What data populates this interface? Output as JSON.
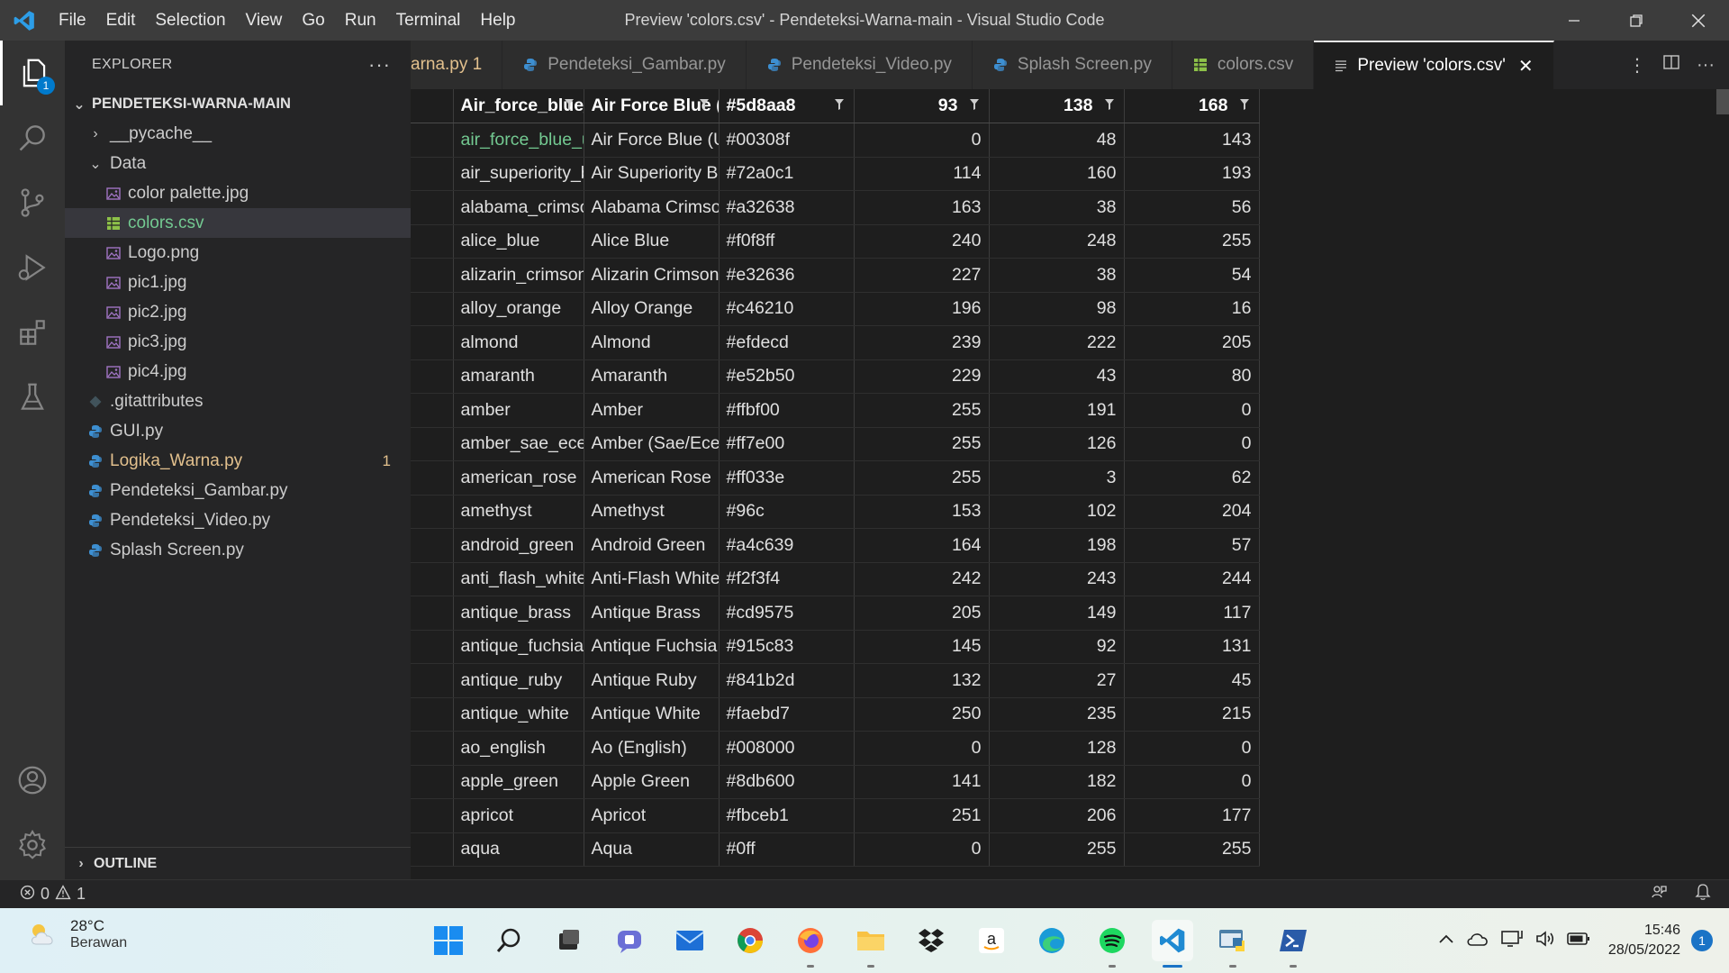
{
  "titlebar": {
    "menu": [
      "File",
      "Edit",
      "Selection",
      "View",
      "Go",
      "Run",
      "Terminal",
      "Help"
    ],
    "title": "Preview 'colors.csv' - Pendeteksi-Warna-main - Visual Studio Code"
  },
  "activity": {
    "explorer_badge": "1"
  },
  "explorer": {
    "header": "EXPLORER",
    "more": "···",
    "root": "PENDETEKSI-WARNA-MAIN",
    "items": [
      {
        "label": "__pycache__",
        "kind": "folder-closed",
        "indent": 1
      },
      {
        "label": "Data",
        "kind": "folder-open",
        "indent": 1
      },
      {
        "label": "color palette.jpg",
        "kind": "image",
        "indent": 2
      },
      {
        "label": "colors.csv",
        "kind": "csv",
        "indent": 2
      },
      {
        "label": "Logo.png",
        "kind": "image",
        "indent": 2
      },
      {
        "label": "pic1.jpg",
        "kind": "image",
        "indent": 2
      },
      {
        "label": "pic2.jpg",
        "kind": "image",
        "indent": 2
      },
      {
        "label": "pic3.jpg",
        "kind": "image",
        "indent": 2
      },
      {
        "label": "pic4.jpg",
        "kind": "image",
        "indent": 2
      },
      {
        "label": ".gitattributes",
        "kind": "git",
        "indent": 1
      },
      {
        "label": "GUI.py",
        "kind": "python",
        "indent": 1
      },
      {
        "label": "Logika_Warna.py",
        "kind": "python",
        "indent": 1,
        "badge": "1"
      },
      {
        "label": "Pendeteksi_Gambar.py",
        "kind": "python",
        "indent": 1
      },
      {
        "label": "Pendeteksi_Video.py",
        "kind": "python",
        "indent": 1
      },
      {
        "label": "Splash Screen.py",
        "kind": "python",
        "indent": 1
      }
    ],
    "outline": "OUTLINE"
  },
  "tabs": [
    {
      "label": "arna.py 1",
      "kind": "python-partial"
    },
    {
      "label": "Pendeteksi_Gambar.py",
      "kind": "python"
    },
    {
      "label": "Pendeteksi_Video.py",
      "kind": "python"
    },
    {
      "label": "Splash Screen.py",
      "kind": "python"
    },
    {
      "label": "colors.csv",
      "kind": "csv"
    },
    {
      "label": "Preview 'colors.csv'",
      "kind": "preview",
      "active": true
    }
  ],
  "table": {
    "headers": [
      "Air_force_blue_",
      "Air Force Blue (",
      "#5d8aa8",
      "93",
      "138",
      "168"
    ],
    "rows": [
      [
        "air_force_blue_u",
        "Air Force Blue (U",
        "#00308f",
        "0",
        "48",
        "143"
      ],
      [
        "air_superiority_b",
        "Air Superiority B",
        "#72a0c1",
        "114",
        "160",
        "193"
      ],
      [
        "alabama_crimso",
        "Alabama Crimso",
        "#a32638",
        "163",
        "38",
        "56"
      ],
      [
        "alice_blue",
        "Alice Blue",
        "#f0f8ff",
        "240",
        "248",
        "255"
      ],
      [
        "alizarin_crimson",
        "Alizarin Crimson",
        "#e32636",
        "227",
        "38",
        "54"
      ],
      [
        "alloy_orange",
        "Alloy Orange",
        "#c46210",
        "196",
        "98",
        "16"
      ],
      [
        "almond",
        "Almond",
        "#efdecd",
        "239",
        "222",
        "205"
      ],
      [
        "amaranth",
        "Amaranth",
        "#e52b50",
        "229",
        "43",
        "80"
      ],
      [
        "amber",
        "Amber",
        "#ffbf00",
        "255",
        "191",
        "0"
      ],
      [
        "amber_sae_ece",
        "Amber (Sae/Ece)",
        "#ff7e00",
        "255",
        "126",
        "0"
      ],
      [
        "american_rose",
        "American Rose",
        "#ff033e",
        "255",
        "3",
        "62"
      ],
      [
        "amethyst",
        "Amethyst",
        "#96c",
        "153",
        "102",
        "204"
      ],
      [
        "android_green",
        "Android Green",
        "#a4c639",
        "164",
        "198",
        "57"
      ],
      [
        "anti_flash_white",
        "Anti-Flash White",
        "#f2f3f4",
        "242",
        "243",
        "244"
      ],
      [
        "antique_brass",
        "Antique Brass",
        "#cd9575",
        "205",
        "149",
        "117"
      ],
      [
        "antique_fuchsia",
        "Antique Fuchsia",
        "#915c83",
        "145",
        "92",
        "131"
      ],
      [
        "antique_ruby",
        "Antique Ruby",
        "#841b2d",
        "132",
        "27",
        "45"
      ],
      [
        "antique_white",
        "Antique White",
        "#faebd7",
        "250",
        "235",
        "215"
      ],
      [
        "ao_english",
        "Ao (English)",
        "#008000",
        "0",
        "128",
        "0"
      ],
      [
        "apple_green",
        "Apple Green",
        "#8db600",
        "141",
        "182",
        "0"
      ],
      [
        "apricot",
        "Apricot",
        "#fbceb1",
        "251",
        "206",
        "177"
      ],
      [
        "aqua",
        "Aqua",
        "#0ff",
        "0",
        "255",
        "255"
      ]
    ]
  },
  "statusbar": {
    "errors": "0",
    "warnings": "1"
  },
  "taskbar": {
    "weather_temp": "28°C",
    "weather_cond": "Berawan",
    "time": "15:46",
    "date": "28/05/2022",
    "notifications": "1"
  },
  "colors": {
    "accent": "#007acc",
    "git_added": "#73c991",
    "git_modified": "#e2c08d"
  }
}
